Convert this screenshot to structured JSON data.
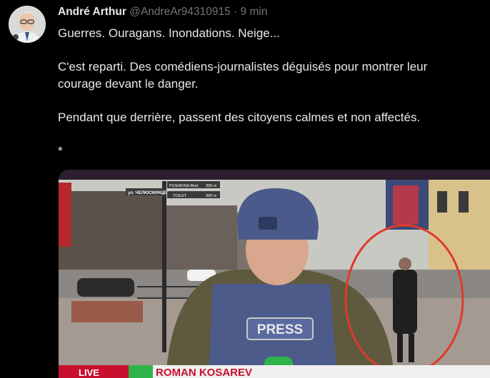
{
  "tweet": {
    "author_name": "André Arthur",
    "handle": "@AndreAr94310915",
    "separator": "·",
    "time": "9 min",
    "lines": [
      "Guerres. Ouragans. Inondations. Neige...",
      "C'est reparti.  Des comédiens-journalistes déguisés pour montrer leur",
      "courage devant le danger.",
      "Pendant que derrière, passent des citoyens calmes et non affectés.",
      "*"
    ]
  },
  "media": {
    "vest_label": "PRESS",
    "ticker_left": "LIVE",
    "ticker_name": "ROMAN KOSAREV",
    "sign_main": "ул. ЧЕЛЮСКИНЦЕВ",
    "sign_street": "PUSHKINA Blvd.",
    "sign_distance_1": "300 m",
    "sign_toilet": "TOILET",
    "sign_distance_2": "300 m"
  },
  "colors": {
    "background": "#000000",
    "text": "#e7e9ea",
    "muted": "#71767b",
    "ticker_red": "#c8102e",
    "highlight_circle": "#e03a2a"
  }
}
